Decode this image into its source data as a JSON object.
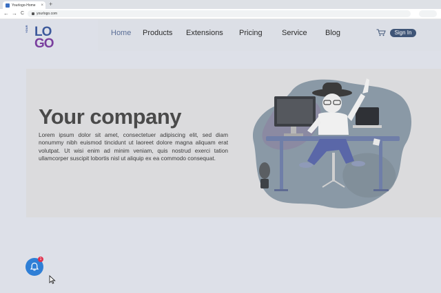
{
  "browser": {
    "tab_title": "Yourlogo-Home",
    "tab_close": "×",
    "new_tab": "+",
    "back": "←",
    "forward": "→",
    "reload": "C",
    "url": "yourlogo.com"
  },
  "logo": {
    "top": "LO",
    "bottom": "GO",
    "side": "YOUR"
  },
  "nav": {
    "items": [
      "Home",
      "Products",
      "Extensions",
      "Pricing",
      "Service",
      "Blog"
    ],
    "active": "Home",
    "signin_label": "Sign In"
  },
  "hero": {
    "headline": "Your company",
    "body": "Lorem ipsum dolor sit amet, consectetuer adipiscing elit, sed diam nonummy nibh euismod tincidunt ut laoreet dolore magna aliquam erat volutpat. Ut wisi enim ad minim veniam, quis nostrud exerci tation ullamcorper suscipit lobortis nisl ut aliquip ex ea commodo consequat."
  },
  "notification": {
    "count": "1"
  },
  "colors": {
    "page_bg": "#dde0e8",
    "hero_bg": "#dbdbdd",
    "logo_blue": "#3d5a9c",
    "logo_purple": "#7a3f9e",
    "signin_bg": "#3f5577",
    "bell_bg": "#2f7fd6",
    "badge_bg": "#e0334f"
  },
  "icons": [
    "favicon-icon",
    "lock-icon",
    "cart-icon",
    "bell-icon",
    "cursor-icon",
    "hero-illustration"
  ]
}
